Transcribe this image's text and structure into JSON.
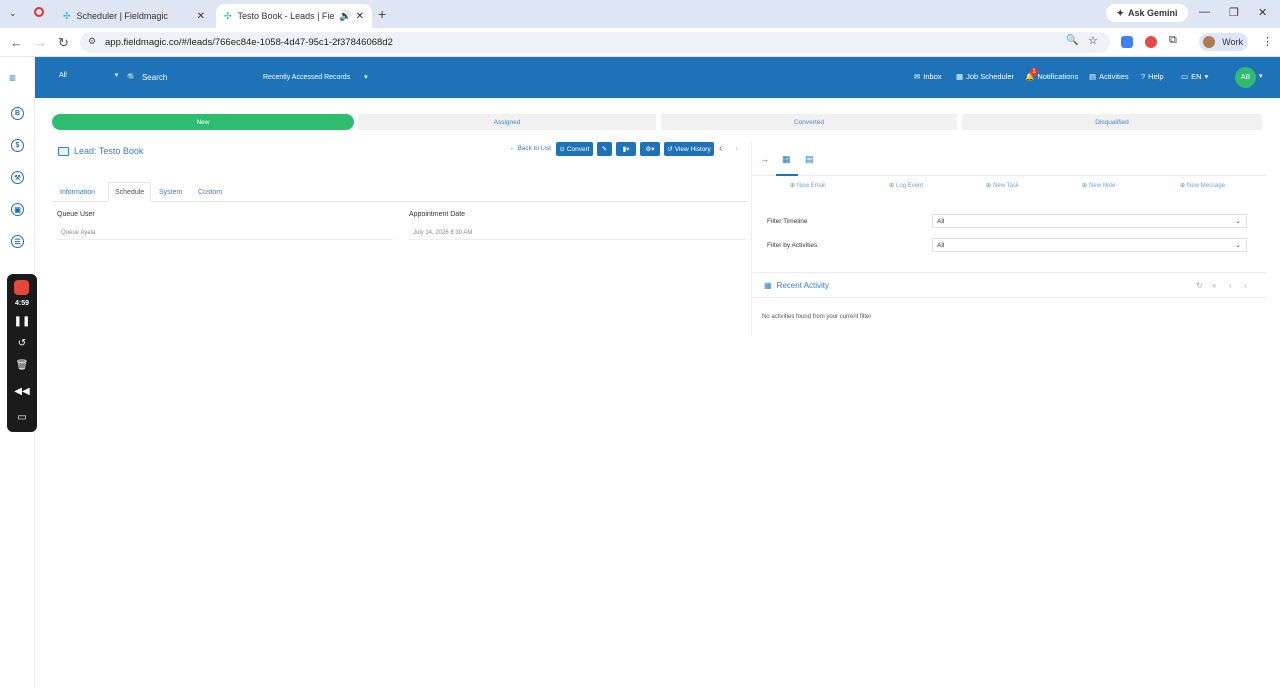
{
  "browser": {
    "tabs": [
      {
        "title": "Scheduler | Fieldmagic",
        "active": false
      },
      {
        "title": "Testo Book - Leads | Fieldm",
        "active": true
      }
    ],
    "ask_gemini": "Ask Gemini",
    "url": "app.fieldmagic.co/#/leads/766ec84e-1058-4d47-95c1-2f37846068d2",
    "profile": "Work"
  },
  "recorder": {
    "time": "4:59"
  },
  "header": {
    "module_select": "All",
    "search_placeholder": "Search",
    "recent_records": "Recently Accessed Records",
    "inbox": "Inbox",
    "job_scheduler": "Job Scheduler",
    "notifications": "Notifications",
    "notification_count": "1",
    "activities": "Activities",
    "help": "Help",
    "language": "EN",
    "user_initials": "AB"
  },
  "stages": [
    "New",
    "Assigned",
    "Converted",
    "Disqualified"
  ],
  "lead": {
    "title": "Lead: Testo Book",
    "back_to_list": "Back to List",
    "convert": "Convert",
    "view_history": "View History"
  },
  "tabs": [
    "Information",
    "Schedule",
    "System",
    "Custom"
  ],
  "fields": {
    "queue_user_label": "Queue User",
    "queue_user_value": "Queue Ayala",
    "appointment_label": "Appointment Date",
    "appointment_value": "July 14, 2026 8:30 AM"
  },
  "right_panel": {
    "actions": [
      "New Email",
      "Log Event",
      "New Task",
      "New Note",
      "New Message"
    ],
    "filter_timeline_label": "Filter Timeline",
    "filter_timeline_value": "All",
    "filter_activities_label": "Filter by Activities",
    "filter_activities_value": "All",
    "recent_activity": "Recent Activity",
    "no_activities": "No activities found from your current filter"
  },
  "colors": {
    "brand_blue": "#1d72b8",
    "stage_active": "#2ebd70",
    "avatar": "#2ebc6e"
  }
}
